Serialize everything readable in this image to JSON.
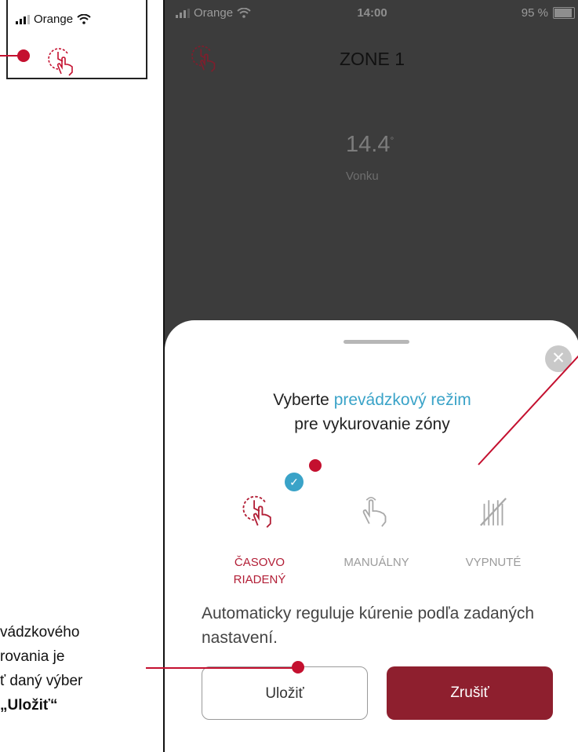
{
  "inset": {
    "carrier": "Orange"
  },
  "status_bar": {
    "carrier": "Orange",
    "time": "14:00",
    "battery": "95 %"
  },
  "header": {
    "title": "ZONE 1"
  },
  "weather": {
    "temperature": "14.4",
    "degree": "°",
    "label": "Vonku"
  },
  "sheet": {
    "heading_prefix": "Vyberte ",
    "heading_highlight": "prevádzkový režim",
    "heading_line2": "pre vykurovanie zóny",
    "close_glyph": "✕",
    "check_glyph": "✓",
    "modes": [
      {
        "label_line1": "ČASOVO",
        "label_line2": "RIADENÝ",
        "icon": "clock-hand-icon",
        "selected": true
      },
      {
        "label_line1": "MANUÁLNY",
        "label_line2": "",
        "icon": "hand-icon",
        "selected": false
      },
      {
        "label_line1": "VYPNUTÉ",
        "label_line2": "",
        "icon": "off-icon",
        "selected": false
      }
    ],
    "description": "Automaticky reguluje kúrenie podľa zadaných nastavení.",
    "save_label": "Uložiť",
    "cancel_label": "Zrušiť"
  },
  "caption": {
    "line1": "vádzkového",
    "line2": "rovania je",
    "line3": "ť daný výber",
    "line4": "„Uložiť“"
  },
  "colors": {
    "accent": "#3aa3c8",
    "brand_red": "#b21e36",
    "cancel_bg": "#8e1f2e",
    "annotation": "#c4102f",
    "phone_bg": "#3c3c3c"
  }
}
